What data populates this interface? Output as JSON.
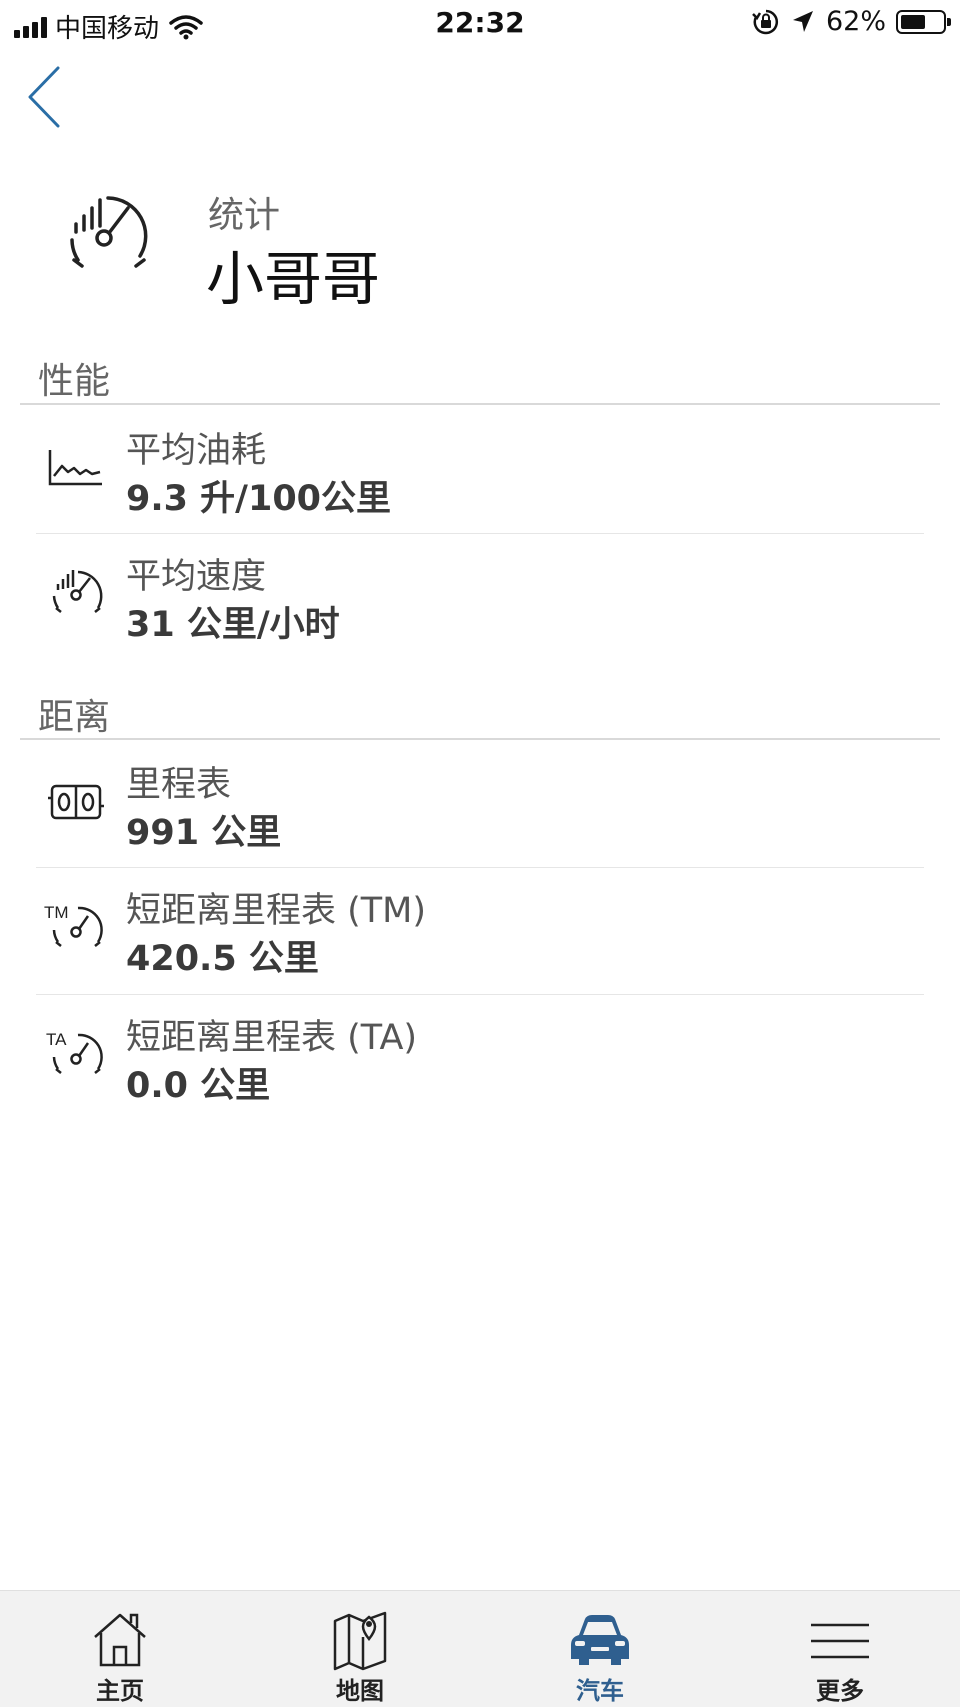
{
  "status_bar": {
    "carrier": "中国移动",
    "time": "22:32",
    "battery_percent": "62%",
    "battery_level": 0.62
  },
  "header": {
    "subtitle": "统计",
    "title": "小哥哥"
  },
  "sections": [
    {
      "title": "性能",
      "items": [
        {
          "icon": "fuel-consumption-chart-icon",
          "label": "平均油耗",
          "value": "9.3 升/100公里"
        },
        {
          "icon": "speedometer-icon",
          "label": "平均速度",
          "value": "31 公里/小时"
        }
      ]
    },
    {
      "title": "距离",
      "items": [
        {
          "icon": "odometer-icon",
          "label": "里程表",
          "value": "991 公里"
        },
        {
          "icon": "trip-meter-tm-icon",
          "label": "短距离里程表 (TM)",
          "value": "420.5 公里"
        },
        {
          "icon": "trip-meter-ta-icon",
          "label": "短距离里程表 (TA)",
          "value": "0.0 公里"
        }
      ]
    }
  ],
  "tab_bar": {
    "tabs": [
      {
        "label": "主页",
        "icon": "home-icon"
      },
      {
        "label": "地图",
        "icon": "map-icon"
      },
      {
        "label": "汽车",
        "icon": "car-icon"
      },
      {
        "label": "更多",
        "icon": "menu-icon"
      }
    ],
    "active_index": 2
  },
  "colors": {
    "accent": "#2f5f8f",
    "back_arrow": "#2a6ea6"
  }
}
